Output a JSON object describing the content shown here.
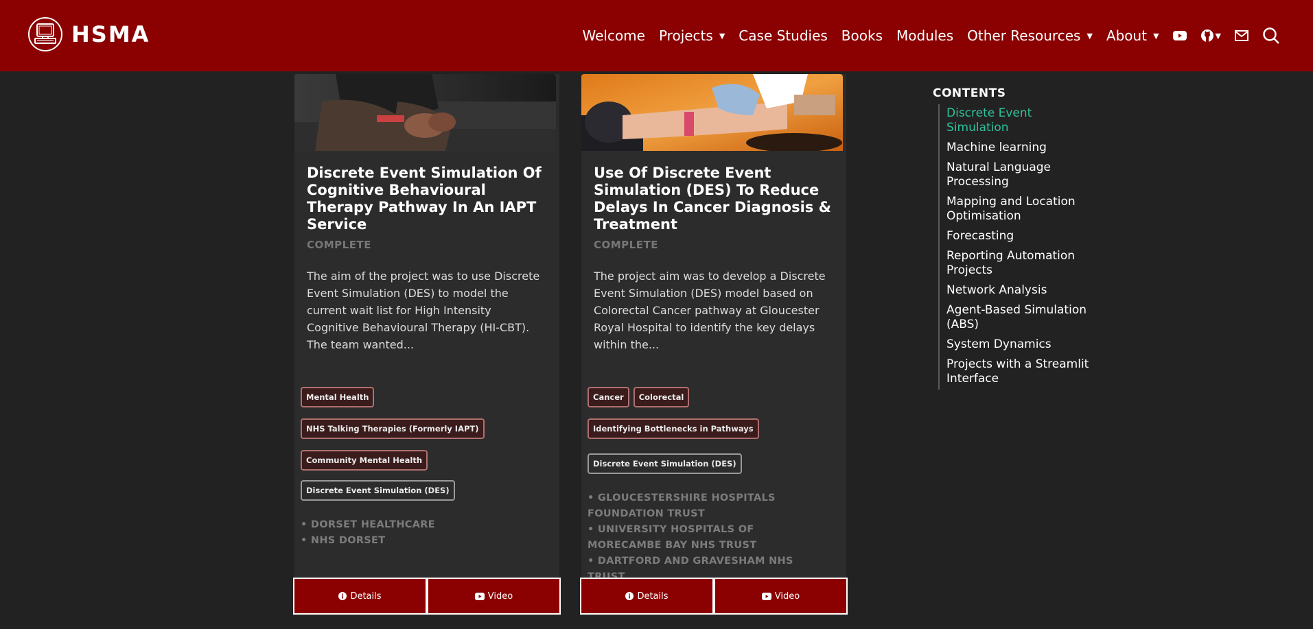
{
  "brand": {
    "name": "HSMA",
    "accent_color": "#8b0000",
    "active_color": "#2fc29a"
  },
  "nav": {
    "items": [
      {
        "label": "Welcome",
        "dropdown": false
      },
      {
        "label": "Projects",
        "dropdown": true
      },
      {
        "label": "Case Studies",
        "dropdown": false
      },
      {
        "label": "Books",
        "dropdown": false
      },
      {
        "label": "Modules",
        "dropdown": false
      },
      {
        "label": "Other Resources",
        "dropdown": true
      },
      {
        "label": "About",
        "dropdown": true
      }
    ],
    "icons": [
      "youtube-icon",
      "github-icon",
      "mail-icon",
      "search-icon"
    ]
  },
  "cards": [
    {
      "title": "Discrete Event Simulation Of Cognitive Behavioural Therapy Pathway In An IAPT Service",
      "status": "COMPLETE",
      "description": "The aim of the project was to use Discrete Event Simulation (DES) to model the current wait list for High Intensity Cognitive Behavioural Therapy (HI-CBT). The team wanted...",
      "tags": [
        "Mental Health",
        "NHS Talking Therapies (Formerly IAPT)",
        "Community Mental Health"
      ],
      "method_tag": "Discrete Event Simulation (DES)",
      "orgs": [
        "• DORSET HEALTHCARE",
        "• NHS DORSET"
      ],
      "details_label": "Details",
      "video_label": "Video"
    },
    {
      "title": "Use Of Discrete Event Simulation (DES) To Reduce Delays In Cancer Diagnosis & Treatment",
      "status": "COMPLETE",
      "description": "The project aim was to develop a Discrete Event Simulation (DES) model based on Colorectal Cancer pathway at Gloucester Royal Hospital to identify the key delays within the...",
      "tags": [
        "Cancer",
        "Colorectal",
        "Identifying Bottlenecks in Pathways"
      ],
      "method_tag": "Discrete Event Simulation (DES)",
      "orgs": [
        "• GLOUCESTERSHIRE HOSPITALS FOUNDATION TRUST",
        "• UNIVERSITY HOSPITALS OF MORECAMBE BAY NHS TRUST",
        "• DARTFORD AND GRAVESHAM NHS TRUST"
      ],
      "details_label": "Details",
      "video_label": "Video"
    }
  ],
  "toc": {
    "title": "CONTENTS",
    "items": [
      "Discrete Event Simulation",
      "Machine learning",
      "Natural Language Processing",
      "Mapping and Location Optimisation",
      "Forecasting",
      "Reporting Automation Projects",
      "Network Analysis",
      "Agent-Based Simulation (ABS)",
      "System Dynamics",
      "Projects with a Streamlit Interface"
    ],
    "active_index": 0
  }
}
